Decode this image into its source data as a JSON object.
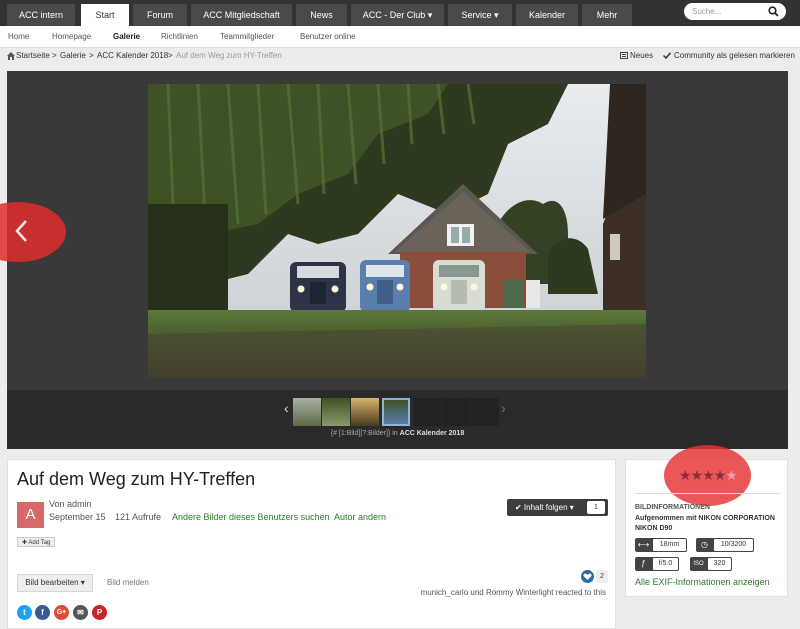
{
  "topnav": {
    "items": [
      "ACC intern",
      "Start",
      "Forum",
      "ACC Mitgliedschaft",
      "News",
      "ACC - Der Club ▾",
      "Service ▾",
      "Kalender",
      "Mehr"
    ],
    "search_placeholder": "Suche..."
  },
  "subnav": {
    "items": [
      "Home",
      "Homepage",
      "Galerie",
      "Richtlinien",
      "Teammitglieder",
      "Benutzer online"
    ]
  },
  "breadcrumb": {
    "items": [
      "Startseite",
      "Galerie",
      "ACC Kalender 2018",
      "Auf dem Weg zum HY-Treffen"
    ],
    "separator": ">",
    "new_label": "Neues",
    "mark_read_label": "Community als gelesen markieren"
  },
  "viewer": {
    "caption_prefix": "{# [1:Bild][?:Bilder]} in",
    "caption_album": "ACC Kalender 2018"
  },
  "image": {
    "title": "Auf dem Weg zum HY-Treffen",
    "avatar_letter": "A",
    "author": "Von admin",
    "date": "September 15",
    "views": "121 Aufrufe",
    "other_images_link": "Andere Bilder dieses Benutzers suchen",
    "change_author_link": "Autor andern",
    "follow_label": "✔ Inhalt folgen ▾",
    "follow_count": "1",
    "add_tag": "✚ Add Tag",
    "edit_label": "Bild bearbeiten ▾",
    "report_label": "Bild melden",
    "reaction_count": "2",
    "reacted_text": "munich_carlo und Rommy Winterlight reacted to this"
  },
  "share": {
    "icons": [
      "twitter-icon",
      "facebook-icon",
      "google-plus-icon",
      "email-icon",
      "pinterest-icon"
    ],
    "glyphs": [
      "t",
      "f",
      "G+",
      "✉",
      "P"
    ],
    "colors": [
      "#1da1f2",
      "#3b5998",
      "#dd4b39",
      "#555555",
      "#cb2027"
    ]
  },
  "sidebar": {
    "rating": 4,
    "rating_max": 5,
    "info_heading": "BILDINFORMATIONEN",
    "camera": "Aufgenommen mit NIKON CORPORATION NIKON D90",
    "exif": [
      {
        "icon": "focal-length-icon",
        "glyph": "⟷",
        "value": "18mm"
      },
      {
        "icon": "shutter-icon",
        "glyph": "◷",
        "value": "10/3200"
      },
      {
        "icon": "aperture-icon",
        "glyph": "ƒ",
        "value": "f/5.0"
      },
      {
        "icon": "iso-icon",
        "glyph": "ISO",
        "value": "320"
      }
    ],
    "all_exif_link": "Alle EXIF-Informationen anzeigen"
  },
  "colors": {
    "topbar": "#333333",
    "link_green": "#2d7a2d",
    "highlight_red": "#e03030"
  }
}
